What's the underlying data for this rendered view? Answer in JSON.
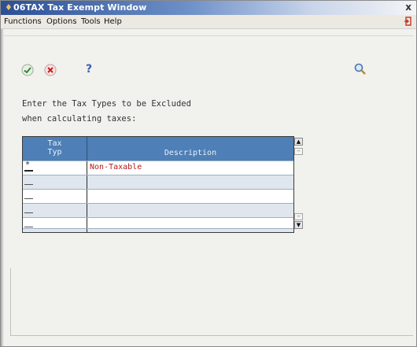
{
  "window": {
    "title": "06TAX  Tax Exempt Window",
    "close_glyph": "x",
    "icon": "app-logo-icon"
  },
  "menu": {
    "items": [
      {
        "label": "Functions"
      },
      {
        "label": "Options"
      },
      {
        "label": "Tools"
      },
      {
        "label": "Help"
      }
    ],
    "exit_icon": "exit-door-icon"
  },
  "toolbar": {
    "ok_icon": "checkmark-icon",
    "cancel_icon": "cancel-x-icon",
    "help_label": "?",
    "search_icon": "search-icon"
  },
  "instructions": {
    "line1": "Enter the Tax Types to be Excluded",
    "line2": "when calculating taxes:"
  },
  "grid": {
    "columns": [
      {
        "label_line1": "Tax",
        "label_line2": "Typ"
      },
      {
        "label": "Description"
      }
    ],
    "rows": [
      {
        "tax_type": "*",
        "description": "Non-Taxable"
      },
      {
        "tax_type": "",
        "description": ""
      },
      {
        "tax_type": "",
        "description": ""
      },
      {
        "tax_type": "",
        "description": ""
      },
      {
        "tax_type": "",
        "description": ""
      },
      {
        "tax_type": "",
        "description": ""
      }
    ]
  },
  "scrollbar": {
    "up_glyph": "▲",
    "down_glyph": "▼"
  },
  "colors": {
    "header_blue": "#4e7fb6",
    "row_alt": "#dfe6ee",
    "text_red": "#b11b1b"
  }
}
